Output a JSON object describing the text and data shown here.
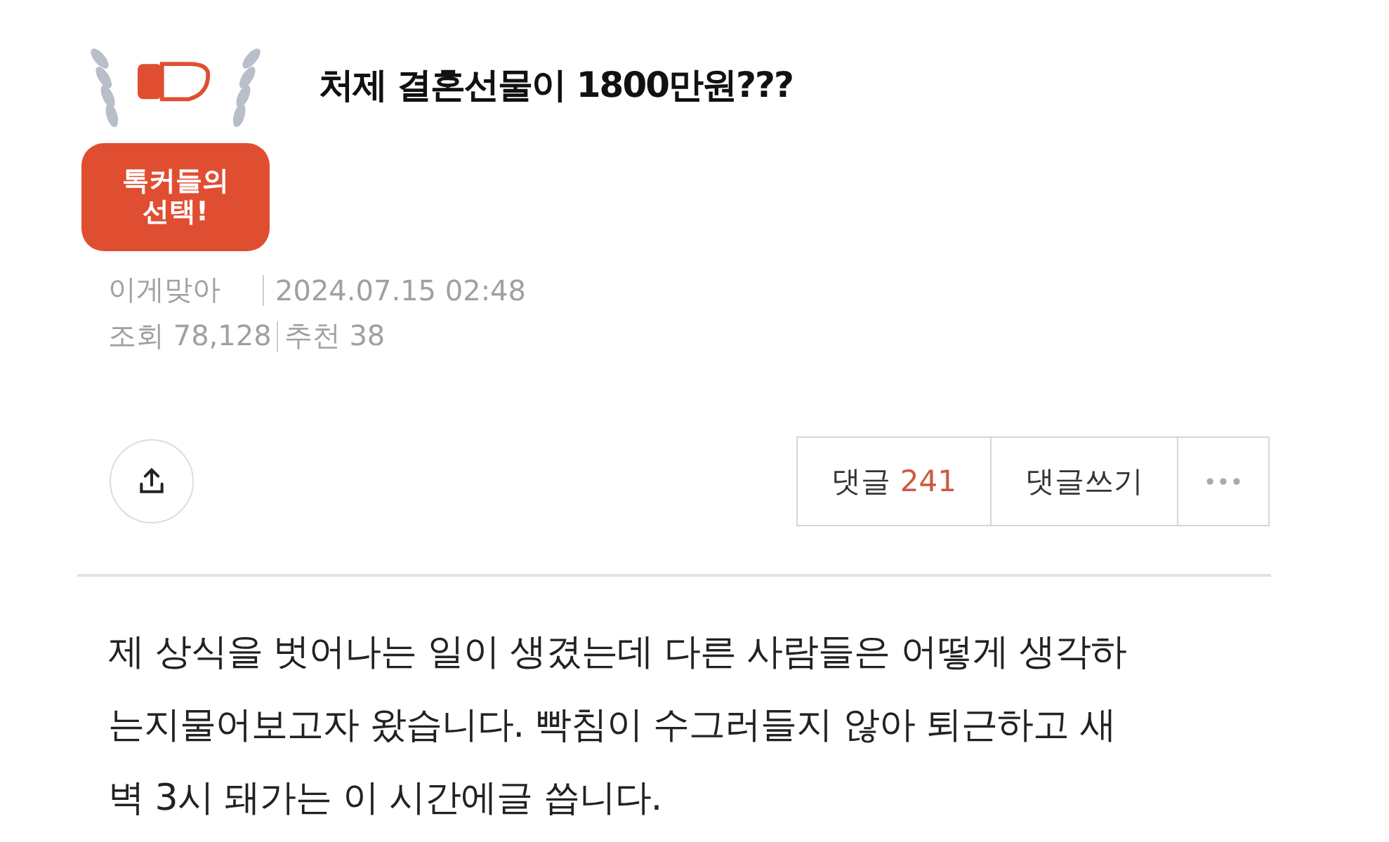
{
  "badge": {
    "lines": [
      "톡커들의",
      "선택!"
    ]
  },
  "post": {
    "title": "처제 결혼선물이 1800만원???",
    "author": "이게맞아",
    "date": "2024.07.15 02:48",
    "views_label": "조회",
    "views": "78,128",
    "recommend_label": "추천",
    "recommend": "38"
  },
  "actions": {
    "comments_label": "댓글",
    "comments_count": "241",
    "write": "댓글쓰기",
    "more": "•••"
  },
  "body": [
    "제 상식을 벗어나는 일이 생겼는데 다른 사람들은 어떻게 생각하",
    "는지물어보고자 왔습니다. 빡침이 수그러들지 않아 퇴근하고 새",
    "벽 3시 돼가는 이 시간에글 씁니다."
  ]
}
